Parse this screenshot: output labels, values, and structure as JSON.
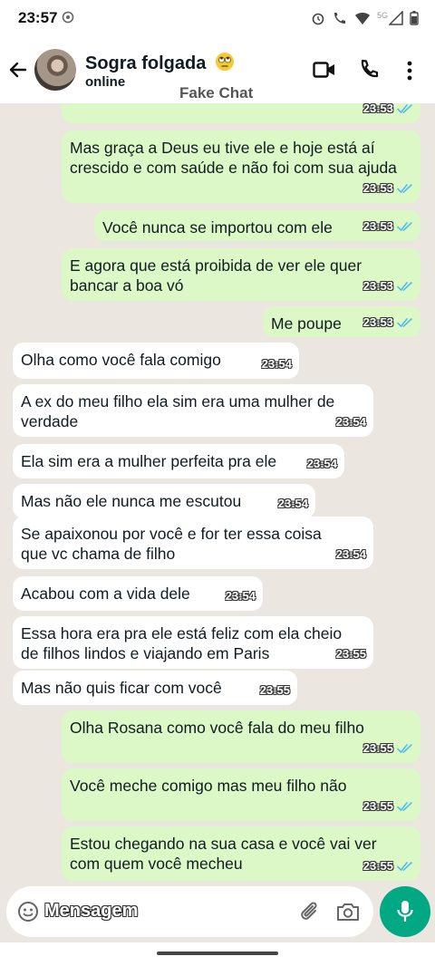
{
  "status_bar": {
    "time": "23:57",
    "network": "5G"
  },
  "header": {
    "contact_name": "Sogra folgada",
    "contact_emoji": "rolling-eyes-emoji",
    "contact_status": "online",
    "watermark": "Fake Chat"
  },
  "messages": [
    {
      "side": "out",
      "text": "",
      "time": "23:53",
      "read": true
    },
    {
      "side": "out",
      "text": "Mas graça a Deus eu tive ele e hoje está aí\ncrescido e com saúde e não foi com sua ajuda",
      "time": "23:53",
      "read": true
    },
    {
      "side": "out",
      "text": "Você nunca se importou com ele",
      "time": "23:53",
      "read": true
    },
    {
      "side": "out",
      "text": "E agora que está proibida de ver ele quer\nbancar a boa vó",
      "time": "23:53",
      "read": true
    },
    {
      "side": "out",
      "text": "Me poupe",
      "time": "23:53",
      "read": true
    },
    {
      "side": "in",
      "text": "Olha como você fala comigo",
      "time": "23:54"
    },
    {
      "side": "in",
      "text": "A ex do meu filho ela sim era uma mulher de\nverdade",
      "time": "23:54"
    },
    {
      "side": "in",
      "text": "Ela sim era a mulher perfeita pra ele",
      "time": "23:54"
    },
    {
      "side": "in",
      "text": "Mas não ele nunca me escutou",
      "time": "23:54"
    },
    {
      "side": "in",
      "text": "Se apaixonou por você e for ter essa coisa\nque vc chama de filho",
      "time": "23:54"
    },
    {
      "side": "in",
      "text": "Acabou com a vida dele",
      "time": "23:54"
    },
    {
      "side": "in",
      "text": "Essa hora era pra ele está feliz com ela cheio\nde filhos lindos e viajando em Paris",
      "time": "23:55"
    },
    {
      "side": "in",
      "text": "Mas não quis ficar com você",
      "time": "23:55"
    },
    {
      "side": "out",
      "text": "Olha Rosana como você fala do meu filho",
      "time": "23:55",
      "read": true
    },
    {
      "side": "out",
      "text": "Você meche comigo mas meu filho não",
      "time": "23:55",
      "read": true
    },
    {
      "side": "out",
      "text": "Estou chegando na sua casa e você vai ver\ncom quem você mecheu",
      "time": "23:55",
      "read": true
    }
  ],
  "input": {
    "placeholder": "Mensagem"
  },
  "colors": {
    "outgoing_bubble": "#dcf8c6",
    "incoming_bubble": "#ffffff",
    "chat_background": "#ebe6df",
    "accent": "#00a884",
    "read_ticks": "#53bdeb"
  },
  "icons": [
    "back-arrow-icon",
    "video-call-icon",
    "phone-icon",
    "menu-dots-icon",
    "emoji-icon",
    "attach-icon",
    "camera-icon",
    "mic-icon"
  ]
}
